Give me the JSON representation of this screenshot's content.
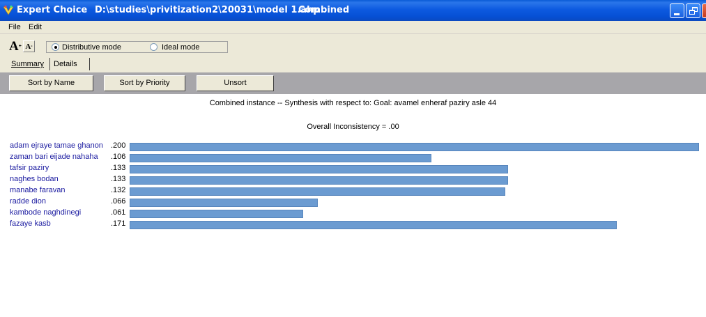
{
  "window": {
    "app_name": "Expert Choice",
    "path": "D:\\studies\\privitization2\\20031\\model 1.ahp",
    "mode": "Combined"
  },
  "menu": {
    "file": "File",
    "edit": "Edit"
  },
  "toolbar": {
    "distributive_label": "Distributive mode",
    "ideal_label": "Ideal mode",
    "selected_mode": "Distributive mode"
  },
  "tabs": {
    "summary": "Summary",
    "details": "Details"
  },
  "sort": {
    "by_name": "Sort by Name",
    "by_priority": "Sort by Priority",
    "unsort": "Unsort"
  },
  "synthesis": {
    "title": "Combined instance -- Synthesis with respect to: Goal: avamel enheraf paziry asle 44",
    "inconsistency": "Overall Inconsistency = .00"
  },
  "colors": {
    "bar": "#6b9bd1",
    "name_text": "#1a1aa0",
    "titlebar": "#0650d4"
  },
  "alternatives": [
    {
      "name": "adam ejraye tamae ghanon",
      "value": ".200",
      "priority": 0.2
    },
    {
      "name": "zaman bari eijade nahaha",
      "value": ".106",
      "priority": 0.106
    },
    {
      "name": "tafsir paziry",
      "value": ".133",
      "priority": 0.133
    },
    {
      "name": "naghes bodan",
      "value": ".133",
      "priority": 0.133
    },
    {
      "name": "manabe faravan",
      "value": ".132",
      "priority": 0.132
    },
    {
      "name": "radde dion",
      "value": ".066",
      "priority": 0.066
    },
    {
      "name": "kambode naghdinegi",
      "value": ".061",
      "priority": 0.061
    },
    {
      "name": "fazaye kasb",
      "value": ".171",
      "priority": 0.171
    }
  ]
}
